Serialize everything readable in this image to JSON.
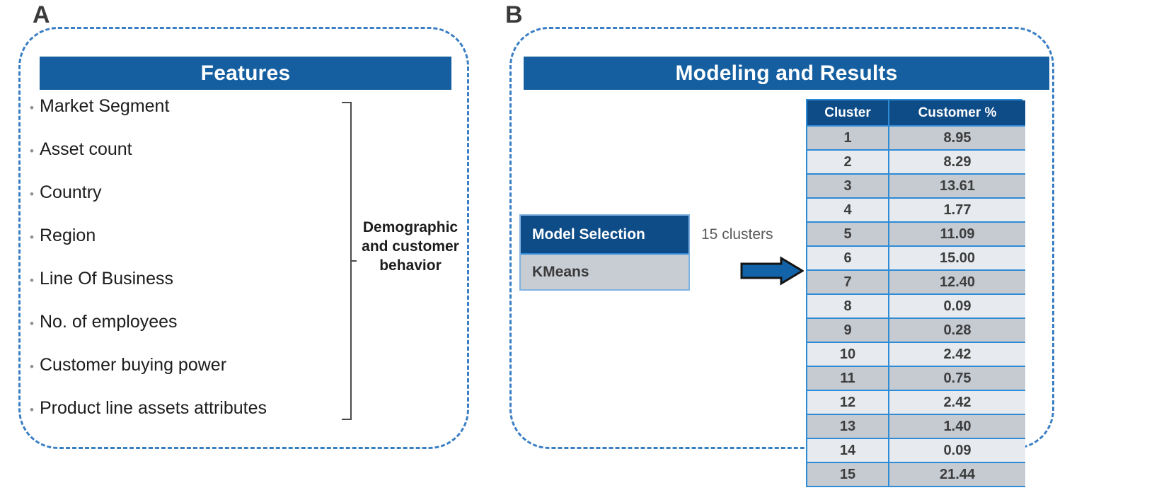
{
  "panels": {
    "a": {
      "label": "A"
    },
    "b": {
      "label": "B"
    }
  },
  "features_panel": {
    "header": "Features",
    "items": [
      "Market Segment",
      "Asset count",
      "Country",
      "Region",
      "Line Of Business",
      "No. of employees",
      "Customer buying power",
      "Product line assets attributes"
    ],
    "bullet_glyph": "•",
    "bracket_caption": "Demographic and customer behavior"
  },
  "modeling_panel": {
    "header": "Modeling and Results",
    "model_selection": {
      "title": "Model Selection",
      "value": "KMeans"
    },
    "arrow_label": "15 clusters",
    "results_table": {
      "columns": [
        "Cluster",
        "Customer %"
      ],
      "rows": [
        [
          "1",
          "8.95"
        ],
        [
          "2",
          "8.29"
        ],
        [
          "3",
          "13.61"
        ],
        [
          "4",
          "1.77"
        ],
        [
          "5",
          "11.09"
        ],
        [
          "6",
          "15.00"
        ],
        [
          "7",
          "12.40"
        ],
        [
          "8",
          "0.09"
        ],
        [
          "9",
          "0.28"
        ],
        [
          "10",
          "2.42"
        ],
        [
          "11",
          "0.75"
        ],
        [
          "12",
          "2.42"
        ],
        [
          "13",
          "1.40"
        ],
        [
          "14",
          "0.09"
        ],
        [
          "15",
          "21.44"
        ]
      ]
    }
  },
  "colors": {
    "header_blue": "#155FA0",
    "box_header_blue": "#0E4C87",
    "grid_blue": "#2E8BD6",
    "panel_dash_blue": "#3a7ec4",
    "row_odd": "#C6CBD2",
    "row_even": "#E7EAEE",
    "arrow_fill": "#1263A8",
    "arrow_stroke": "#141414"
  }
}
